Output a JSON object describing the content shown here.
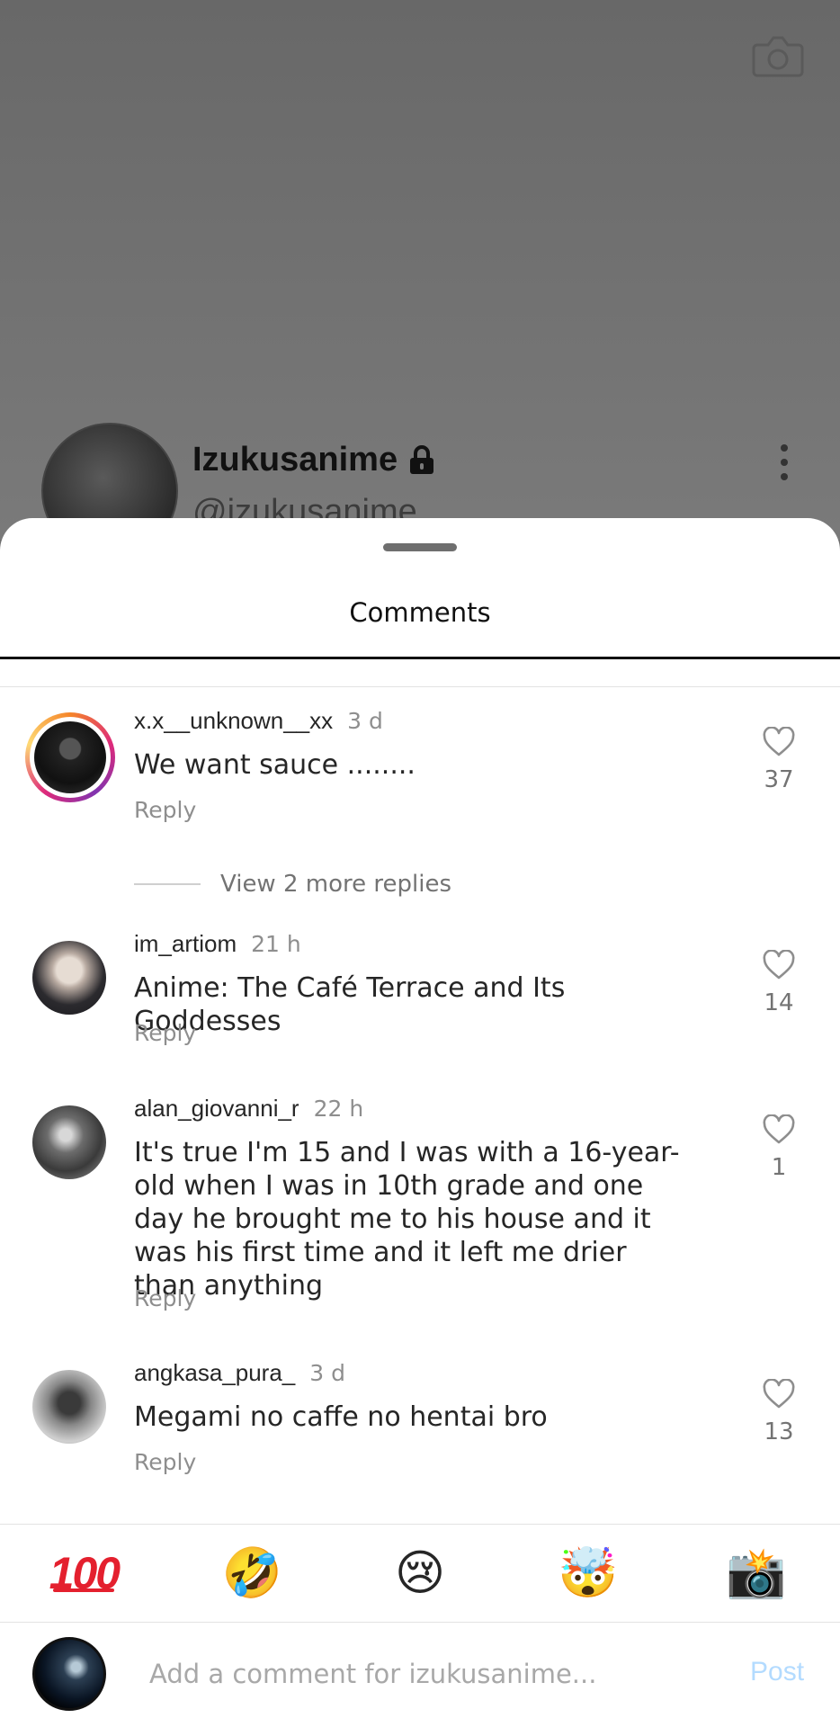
{
  "background_profile": {
    "name": "Izukusanime",
    "handle": "@izukusanime",
    "icons": [
      "camera-icon",
      "lock-icon",
      "more-vertical-icon"
    ]
  },
  "sheet": {
    "title": "Comments"
  },
  "comments": [
    {
      "username": "x.x__unknown__xx",
      "time": "3 d",
      "text": "We want sauce ........",
      "reply_label": "Reply",
      "likes": "37",
      "story_ring": true
    },
    {
      "username": "im_artiom",
      "time": "21 h",
      "text": "Anime: The Café Terrace and Its Goddesses",
      "reply_label": "Reply",
      "likes": "14"
    },
    {
      "username": "alan_giovanni_r",
      "time": "22 h",
      "text": "It's true I'm 15 and I was with a 16-year-old when I was in 10th grade and one day he brought me to his house and it was his first time and it left me drier than anything",
      "reply_label": "Reply",
      "likes": "1"
    },
    {
      "username": "angkasa_pura_",
      "time": "3 d",
      "text": "Megami no caffe no hentai bro",
      "reply_label": "Reply",
      "likes": "13"
    }
  ],
  "view_replies": "View 2 more replies",
  "emoji_bar": [
    {
      "name": "hundred-points-emoji",
      "glyph": "100"
    },
    {
      "name": "rolling-laughing-emoji",
      "glyph": "🤣"
    },
    {
      "name": "crying-face-emoji",
      "glyph": "😢"
    },
    {
      "name": "exploding-head-emoji",
      "glyph": "🤯"
    },
    {
      "name": "camera-flash-emoji",
      "glyph": "📸"
    }
  ],
  "input": {
    "placeholder": "Add a comment for izukusanime...",
    "post_label": "Post"
  },
  "colors": {
    "post_disabled": "#b3dbff",
    "secondary_text": "#8e8e8e"
  }
}
